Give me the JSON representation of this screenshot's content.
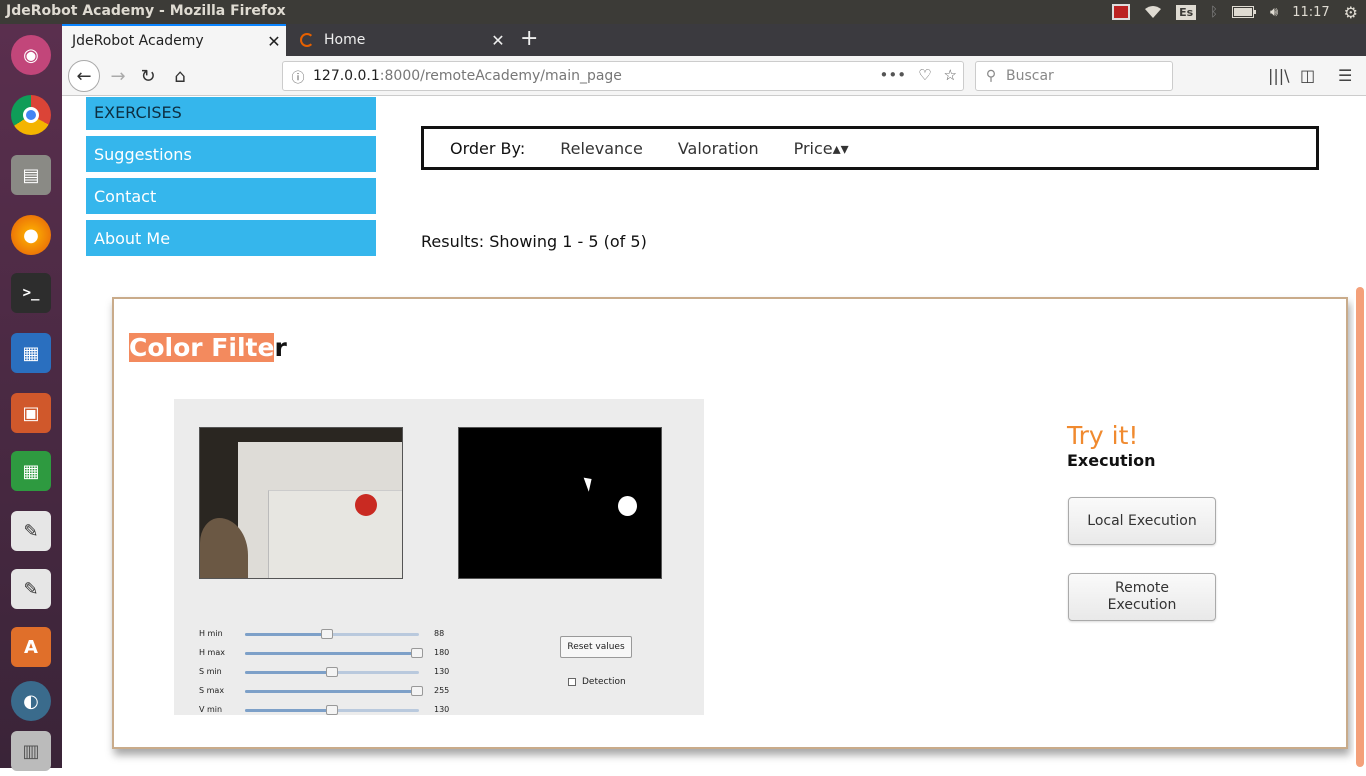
{
  "os": {
    "window_title": "JdeRobot Academy - Mozilla Firefox",
    "keyboard_layout": "Es",
    "clock": "11:17"
  },
  "browser": {
    "tabs": [
      {
        "label": "JdeRobot Academy",
        "active": true
      },
      {
        "label": "Home",
        "active": false
      }
    ],
    "url_host": "127.0.0.1",
    "url_path": ":8000/remoteAcademy/main_page",
    "search_placeholder": "Buscar"
  },
  "sidebar": {
    "items": [
      {
        "label": "EXERCISES"
      },
      {
        "label": "Suggestions"
      },
      {
        "label": "Contact"
      },
      {
        "label": "About Me"
      }
    ]
  },
  "order": {
    "label": "Order By:",
    "options": [
      "Relevance",
      "Valoration",
      "Price▴▾"
    ]
  },
  "results": {
    "text": "Results: Showing 1 - 5 (of 5)"
  },
  "exercise": {
    "title_highlight": "Color Filte",
    "title_rest": "r",
    "try_it": "Try it!",
    "execution_label": "Execution",
    "local_button": "Local Execution",
    "remote_button": "Remote Execution",
    "preview": {
      "sliders": [
        {
          "label": "H min",
          "value": "88",
          "fraction": 0.48
        },
        {
          "label": "H max",
          "value": "180",
          "fraction": 1.0
        },
        {
          "label": "S min",
          "value": "130",
          "fraction": 0.51
        },
        {
          "label": "S max",
          "value": "255",
          "fraction": 1.0
        },
        {
          "label": "V min",
          "value": "130",
          "fraction": 0.51
        }
      ],
      "reset_label": "Reset values",
      "detection_label": "Detection"
    }
  },
  "colors": {
    "sidebar_bg": "#35b6ec",
    "title_highlight": "#f38a5e",
    "try_it": "#f08a2f"
  }
}
